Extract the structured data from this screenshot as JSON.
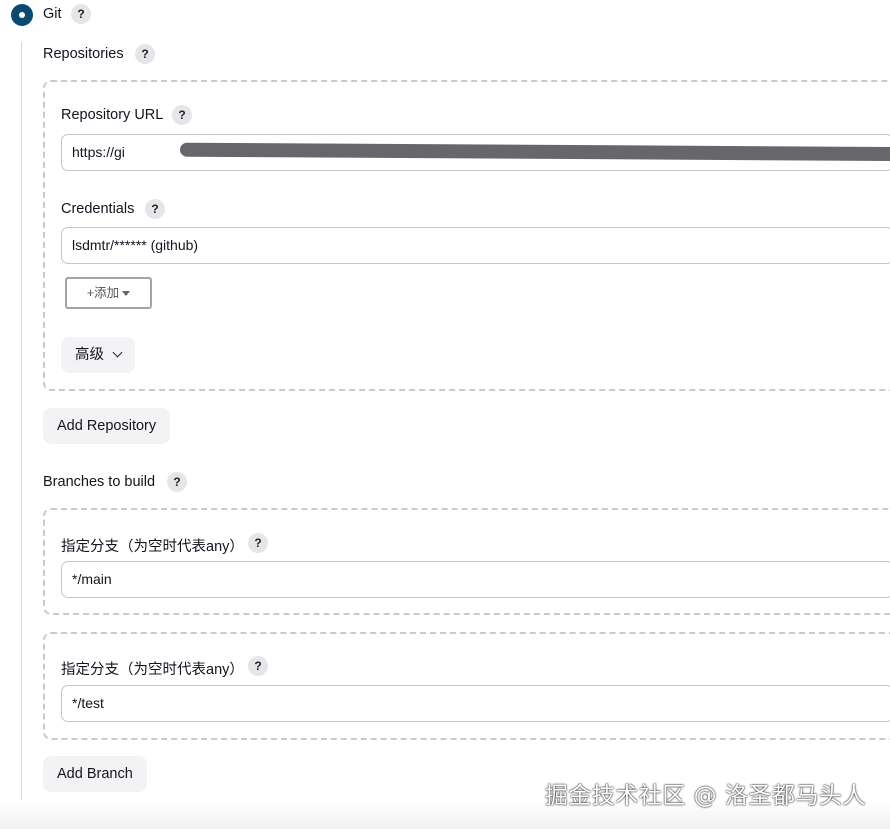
{
  "scm": {
    "label": "Git",
    "help": "?"
  },
  "repositories": {
    "label": "Repositories",
    "help": "?",
    "repo_url": {
      "label": "Repository URL",
      "help": "?",
      "value": "https://gi"
    },
    "credentials": {
      "label": "Credentials",
      "help": "?",
      "value": "lsdmtr/****** (github)"
    },
    "add_button": {
      "plus": "+",
      "label": "添加"
    },
    "advanced_button": {
      "label": "高级"
    },
    "add_repository_label": "Add Repository"
  },
  "branches": {
    "label": "Branches to build",
    "help": "?",
    "items": [
      {
        "label": "指定分支（为空时代表any）",
        "help": "?",
        "value": "*/main"
      },
      {
        "label": "指定分支（为空时代表any）",
        "help": "?",
        "value": "*/test"
      }
    ],
    "add_branch_label": "Add Branch"
  },
  "watermark": "掘金技术社区 @ 洛圣都马头人"
}
